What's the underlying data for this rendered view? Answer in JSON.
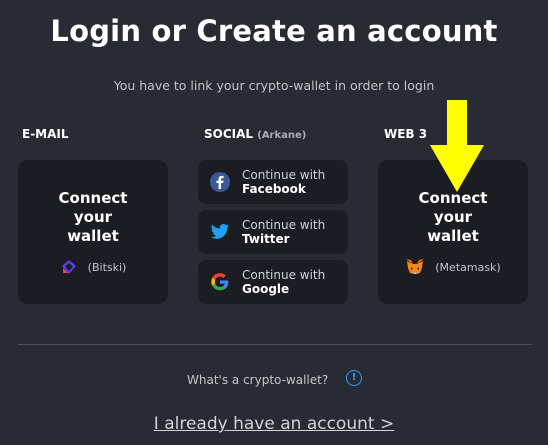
{
  "header": {
    "title": "Login or Create an account",
    "subtitle": "You have to link your crypto-wallet in order to login"
  },
  "columns": {
    "email": {
      "label": "E-MAIL",
      "card_title": "Connect your wallet",
      "provider": "(Bitski)",
      "icon": "bitski-icon"
    },
    "social": {
      "label": "SOCIAL",
      "label_sub": "(Arkane)",
      "buttons": [
        {
          "line1": "Continue with",
          "line2": "Facebook",
          "icon": "facebook-icon"
        },
        {
          "line1": "Continue with",
          "line2": "Twitter",
          "icon": "twitter-icon"
        },
        {
          "line1": "Continue with",
          "line2": "Google",
          "icon": "google-icon"
        }
      ]
    },
    "web3": {
      "label": "WEB 3",
      "card_title": "Connect your wallet",
      "provider": "(Metamask)",
      "icon": "metamask-icon"
    }
  },
  "footer": {
    "whats_wallet": "What's a crypto-wallet?",
    "info_glyph": "!",
    "have_account": "I already have an account >"
  },
  "colors": {
    "background": "#282b33",
    "card": "#1b1d23",
    "facebook": "#3b5998",
    "twitter": "#1da1f2",
    "info": "#2f9bff",
    "arrow": "#ffff00"
  }
}
